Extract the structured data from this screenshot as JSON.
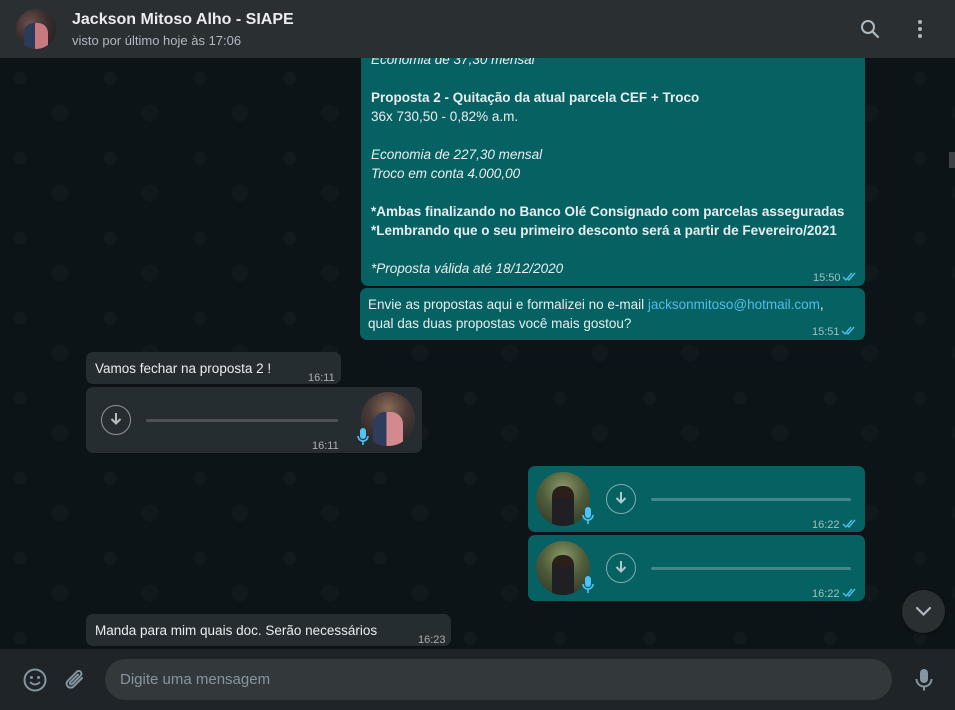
{
  "header": {
    "contact_name": "Jackson Mitoso Alho - SIAPE",
    "status": "visto por último hoje às 17:06",
    "icons": [
      "search-icon",
      "menu-dots-icon"
    ]
  },
  "messages": {
    "proposal": {
      "top_partial": "Economia de 37,30 mensal",
      "p2_title": "Proposta 2  - Quitação da atual parcela CEF + Troco",
      "p2_terms": "36x  730,50 - 0,82% a.m.",
      "p2_economy": "Economia de 227,30 mensal",
      "p2_change": "Troco em conta 4.000,00",
      "note1": "*Ambas finalizando no Banco Olé Consignado com parcelas asseguradas",
      "note2": "*Lembrando que o seu primeiro desconto será a partir de Fevereiro/2021",
      "validity": "*Proposta válida até 18/12/2020",
      "time": "15:50"
    },
    "sent_email": {
      "text_before": "Envie as propostas aqui e formalizei no e-mail ",
      "email": "jacksonmitoso@hotmail.com",
      "text_after": ",",
      "line2": "qual das duas propostas você mais gostou?",
      "time": "15:51"
    },
    "reply1": {
      "text": "Vamos fechar na proposta 2 !",
      "time": "16:11"
    },
    "voice_in": {
      "time": "16:11"
    },
    "voice_out1": {
      "time": "16:22"
    },
    "voice_out2": {
      "time": "16:22"
    },
    "reply2": {
      "text": "Manda para mim quais doc. Serão  necessários",
      "time": "16:23"
    }
  },
  "footer": {
    "placeholder": "Digite uma mensagem",
    "icons": [
      "emoji-icon",
      "paperclip-icon",
      "microphone-icon"
    ]
  },
  "colors": {
    "outgoing_bubble": "#056162",
    "incoming_bubble": "#262d31",
    "read_ticks": "#53bdeb",
    "link": "#53bdeb"
  }
}
